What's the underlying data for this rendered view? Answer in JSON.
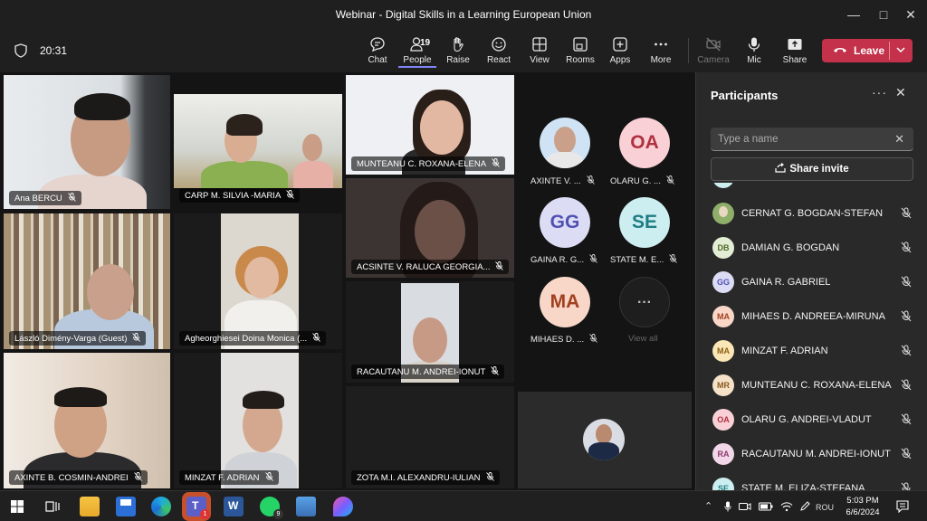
{
  "window": {
    "title": "Webinar - Digital Skills in a Learning European Union"
  },
  "meeting": {
    "time": "20:31",
    "toolbar": [
      {
        "label": "Chat",
        "icon": "chat-icon"
      },
      {
        "label": "People",
        "icon": "people-icon",
        "count": "19",
        "active": true
      },
      {
        "label": "Raise",
        "icon": "raise-hand-icon"
      },
      {
        "label": "React",
        "icon": "react-icon"
      },
      {
        "label": "View",
        "icon": "view-icon"
      },
      {
        "label": "Rooms",
        "icon": "rooms-icon"
      },
      {
        "label": "Apps",
        "icon": "apps-icon"
      },
      {
        "label": "More",
        "icon": "more-icon"
      },
      {
        "label": "Camera",
        "icon": "camera-off-icon",
        "disabled": true
      },
      {
        "label": "Mic",
        "icon": "mic-icon"
      },
      {
        "label": "Share",
        "icon": "share-icon"
      }
    ],
    "leave_label": "Leave"
  },
  "video_tiles": [
    "Ana BERCU",
    "CARP M. SILVIA -MARIA",
    "MUNTEANU C. ROXANA-ELENA",
    "László Dimény-Varga (Guest)",
    "Agheorghiesei Doina Monica (...",
    "ACSINTE V. RALUCA GEORGIA...",
    "RACAUTANU M. ANDREI-IONUT",
    "AXINTE B. COSMIN-ANDREI",
    "MINZAT F. ADRIAN",
    "ZOTA M.I. ALEXANDRU-IULIAN"
  ],
  "avatar_tiles": [
    {
      "initials": "",
      "name": "AXINTE V. ...",
      "color": "#cfe3f5"
    },
    {
      "initials": "OA",
      "name": "OLARU G. ...",
      "color": "#f9d0d5",
      "text_color": "#b0303f"
    },
    {
      "initials": "GG",
      "name": "GAINA R. G...",
      "color": "#dcdcf5",
      "text_color": "#4f52b2"
    },
    {
      "initials": "SE",
      "name": "STATE M. E...",
      "color": "#cdeef0",
      "text_color": "#1d7d84"
    },
    {
      "initials": "MA",
      "name": "MIHAES D. ...",
      "color": "#f8d7c8",
      "text_color": "#a2401f"
    },
    {
      "initials": "···",
      "name": "View all",
      "color": "#292929"
    }
  ],
  "panel": {
    "title": "Participants",
    "search_placeholder": "Type a name",
    "share_invite": "Share invite",
    "participants": [
      {
        "initials": "",
        "name": "CERNAT G. BOGDAN-STEFAN",
        "color": "#8fae6a"
      },
      {
        "initials": "DB",
        "name": "DAMIAN G. BOGDAN",
        "color": "#e3ecd5",
        "text_color": "#4d6b2a"
      },
      {
        "initials": "GG",
        "name": "GAINA R. GABRIEL",
        "color": "#dcdcf5",
        "text_color": "#4f52b2"
      },
      {
        "initials": "MA",
        "name": "MIHAES D. ANDREEA-MIRUNA",
        "color": "#f8d7c8",
        "text_color": "#a2401f"
      },
      {
        "initials": "MA",
        "name": "MINZAT F. ADRIAN",
        "color": "#fae6b6",
        "text_color": "#8a6116"
      },
      {
        "initials": "MR",
        "name": "MUNTEANU C. ROXANA-ELENA",
        "color": "#f6e2c8",
        "text_color": "#8c5a20"
      },
      {
        "initials": "OA",
        "name": "OLARU G. ANDREI-VLADUT",
        "color": "#f9d0d5",
        "text_color": "#b0303f"
      },
      {
        "initials": "RA",
        "name": "RACAUTANU M. ANDREI-IONUT",
        "color": "#f2d7e8",
        "text_color": "#8e3a6d"
      },
      {
        "initials": "SE",
        "name": "STATE M. ELIZA-STEFANA",
        "color": "#cdeef0",
        "text_color": "#1d7d84"
      }
    ]
  },
  "taskbar": {
    "apps": [
      "Start",
      "Task View",
      "File Explorer",
      "Save",
      "Edge",
      "Teams",
      "Word",
      "WhatsApp",
      "Photos",
      "Paint"
    ],
    "teams_badge": "1",
    "whatsapp_badge": "9",
    "language": "ROU",
    "time": "5:03 PM",
    "date": "6/6/2024"
  }
}
